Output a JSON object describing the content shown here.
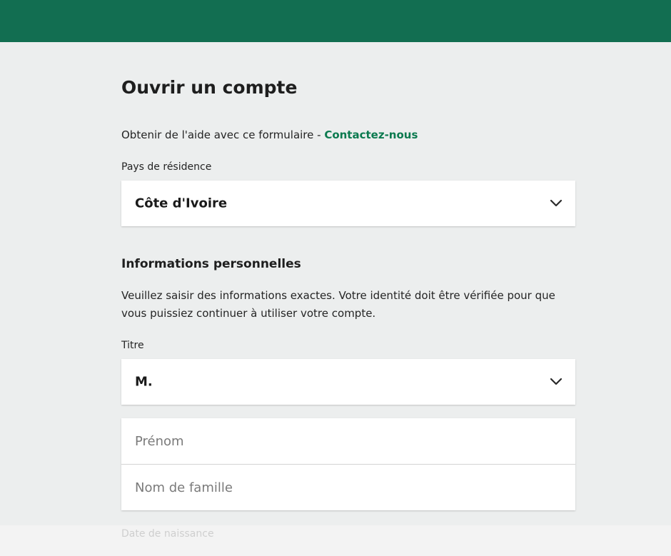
{
  "colors": {
    "header": "#126e51",
    "link": "#0b7a4f",
    "background": "#eceeee"
  },
  "page": {
    "title": "Ouvrir un compte"
  },
  "help": {
    "text": "Obtenir de l'aide avec ce formulaire - ",
    "link_label": "Contactez-nous"
  },
  "residence": {
    "label": "Pays de résidence",
    "value": "Côte d'Ivoire",
    "icon": "chevron-down-icon"
  },
  "personal": {
    "title": "Informations personnelles",
    "description": "Veuillez saisir des informations exactes. Votre identité doit être vérifiée pour que vous puissiez continuer à utiliser votre compte."
  },
  "salutation": {
    "label": "Titre",
    "value": "M.",
    "icon": "chevron-down-icon"
  },
  "first_name": {
    "value": "",
    "placeholder": "Prénom"
  },
  "last_name": {
    "value": "",
    "placeholder": "Nom de famille"
  },
  "birthdate": {
    "label": "Date de naissance"
  }
}
